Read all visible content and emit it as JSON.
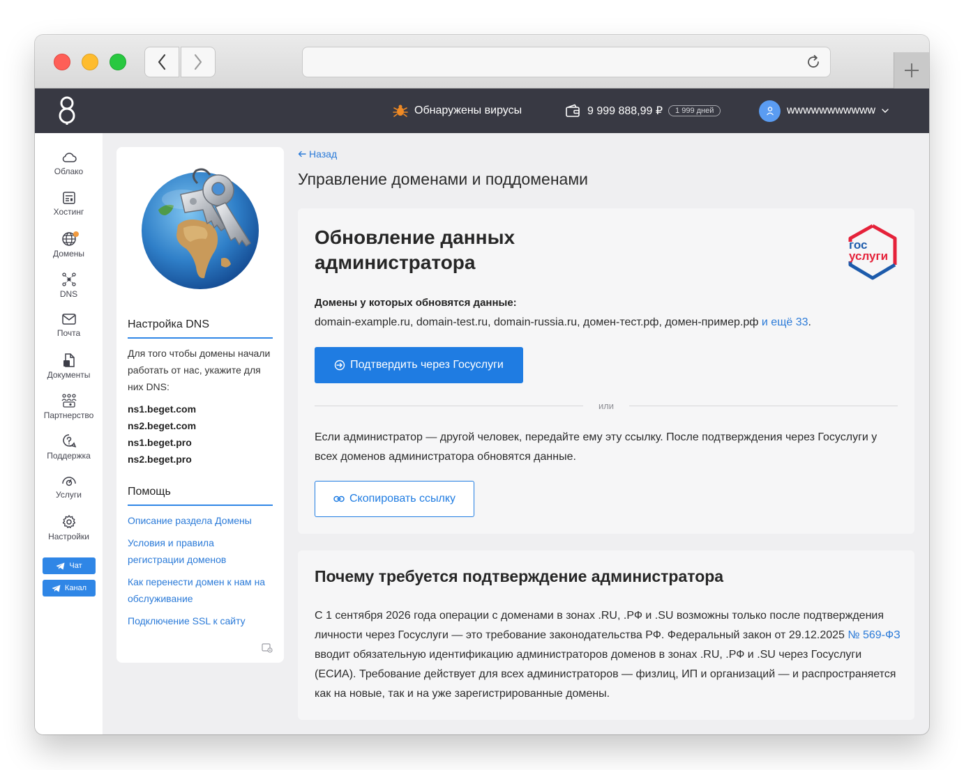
{
  "header": {
    "virus_text": "Обнаружены вирусы",
    "balance": "9 999 888,99 ₽",
    "days": "1 999 дней",
    "username": "wwwwwwwwwww"
  },
  "sidebar": {
    "items": [
      {
        "label": "Облако",
        "icon": "cloud-icon"
      },
      {
        "label": "Хостинг",
        "icon": "hosting-icon"
      },
      {
        "label": "Домены",
        "icon": "globe-icon"
      },
      {
        "label": "DNS",
        "icon": "dns-icon"
      },
      {
        "label": "Почта",
        "icon": "mail-icon"
      },
      {
        "label": "Документы",
        "icon": "documents-icon"
      },
      {
        "label": "Партнерство",
        "icon": "partners-icon"
      },
      {
        "label": "Поддержка",
        "icon": "support-icon"
      },
      {
        "label": "Услуги",
        "icon": "services-icon"
      },
      {
        "label": "Настройки",
        "icon": "gear-icon"
      }
    ],
    "chat_label": "Чат",
    "channel_label": "Канал"
  },
  "left_panel": {
    "dns_title": "Настройка DNS",
    "dns_text": "Для того чтобы домены начали работать от нас, укажите для них DNS:",
    "ns": [
      "ns1.beget.com",
      "ns2.beget.com",
      "ns1.beget.pro",
      "ns2.beget.pro"
    ],
    "help_title": "Помощь",
    "help_links": [
      "Описание раздела Домены",
      "Условия и правила регистрации доменов",
      "Как перенести домен к нам на обслуживание",
      "Подключение SSL к сайту"
    ]
  },
  "main": {
    "back": "Назад",
    "title": "Управление доменами и поддоменами",
    "card1": {
      "heading": "Обновление данных администратора",
      "gosuslugi_top": "гос",
      "gosuslugi_bottom": "услуги",
      "domains_label": "Домены у которых обновятся данные:",
      "domains": "domain-example.ru, domain-test.ru, domain-russia.ru, домен-тест.рф, домен-пример.рф",
      "more": "и ещё 33",
      "confirm_button": "Подтвердить через Госуслуги",
      "or": "или",
      "paragraph": "Если администратор — другой человек, передайте ему эту ссылку. После подтверждения через Госуслуги у всех доменов администратора обновятся данные.",
      "copy_button": "Скопировать ссылку"
    },
    "card2": {
      "heading": "Почему требуется подтверждение администратора",
      "text_before": "С 1 сентября 2026 года операции с доменами в зонах .RU, .РФ и .SU возможны только после подтверждения личности через Госуслуги — это требование законодательства РФ. Федеральный закон от 29.12.2025 ",
      "law_link": "№ 569-ФЗ",
      "text_after": " вводит обязательную идентификацию администраторов доменов в зонах .RU, .РФ и .SU через Госуслуги (ЕСИА). Требование действует для всех администраторов — физлиц, ИП и организаций — и распространяется как на новые, так и на уже зарегистрированные домены."
    }
  },
  "colors": {
    "header_bg": "#383943",
    "accent": "#1f7ce2",
    "link": "#2a7ad8",
    "gosuslugi_red": "#e5223a",
    "gosuslugi_blue": "#1d5bab"
  }
}
